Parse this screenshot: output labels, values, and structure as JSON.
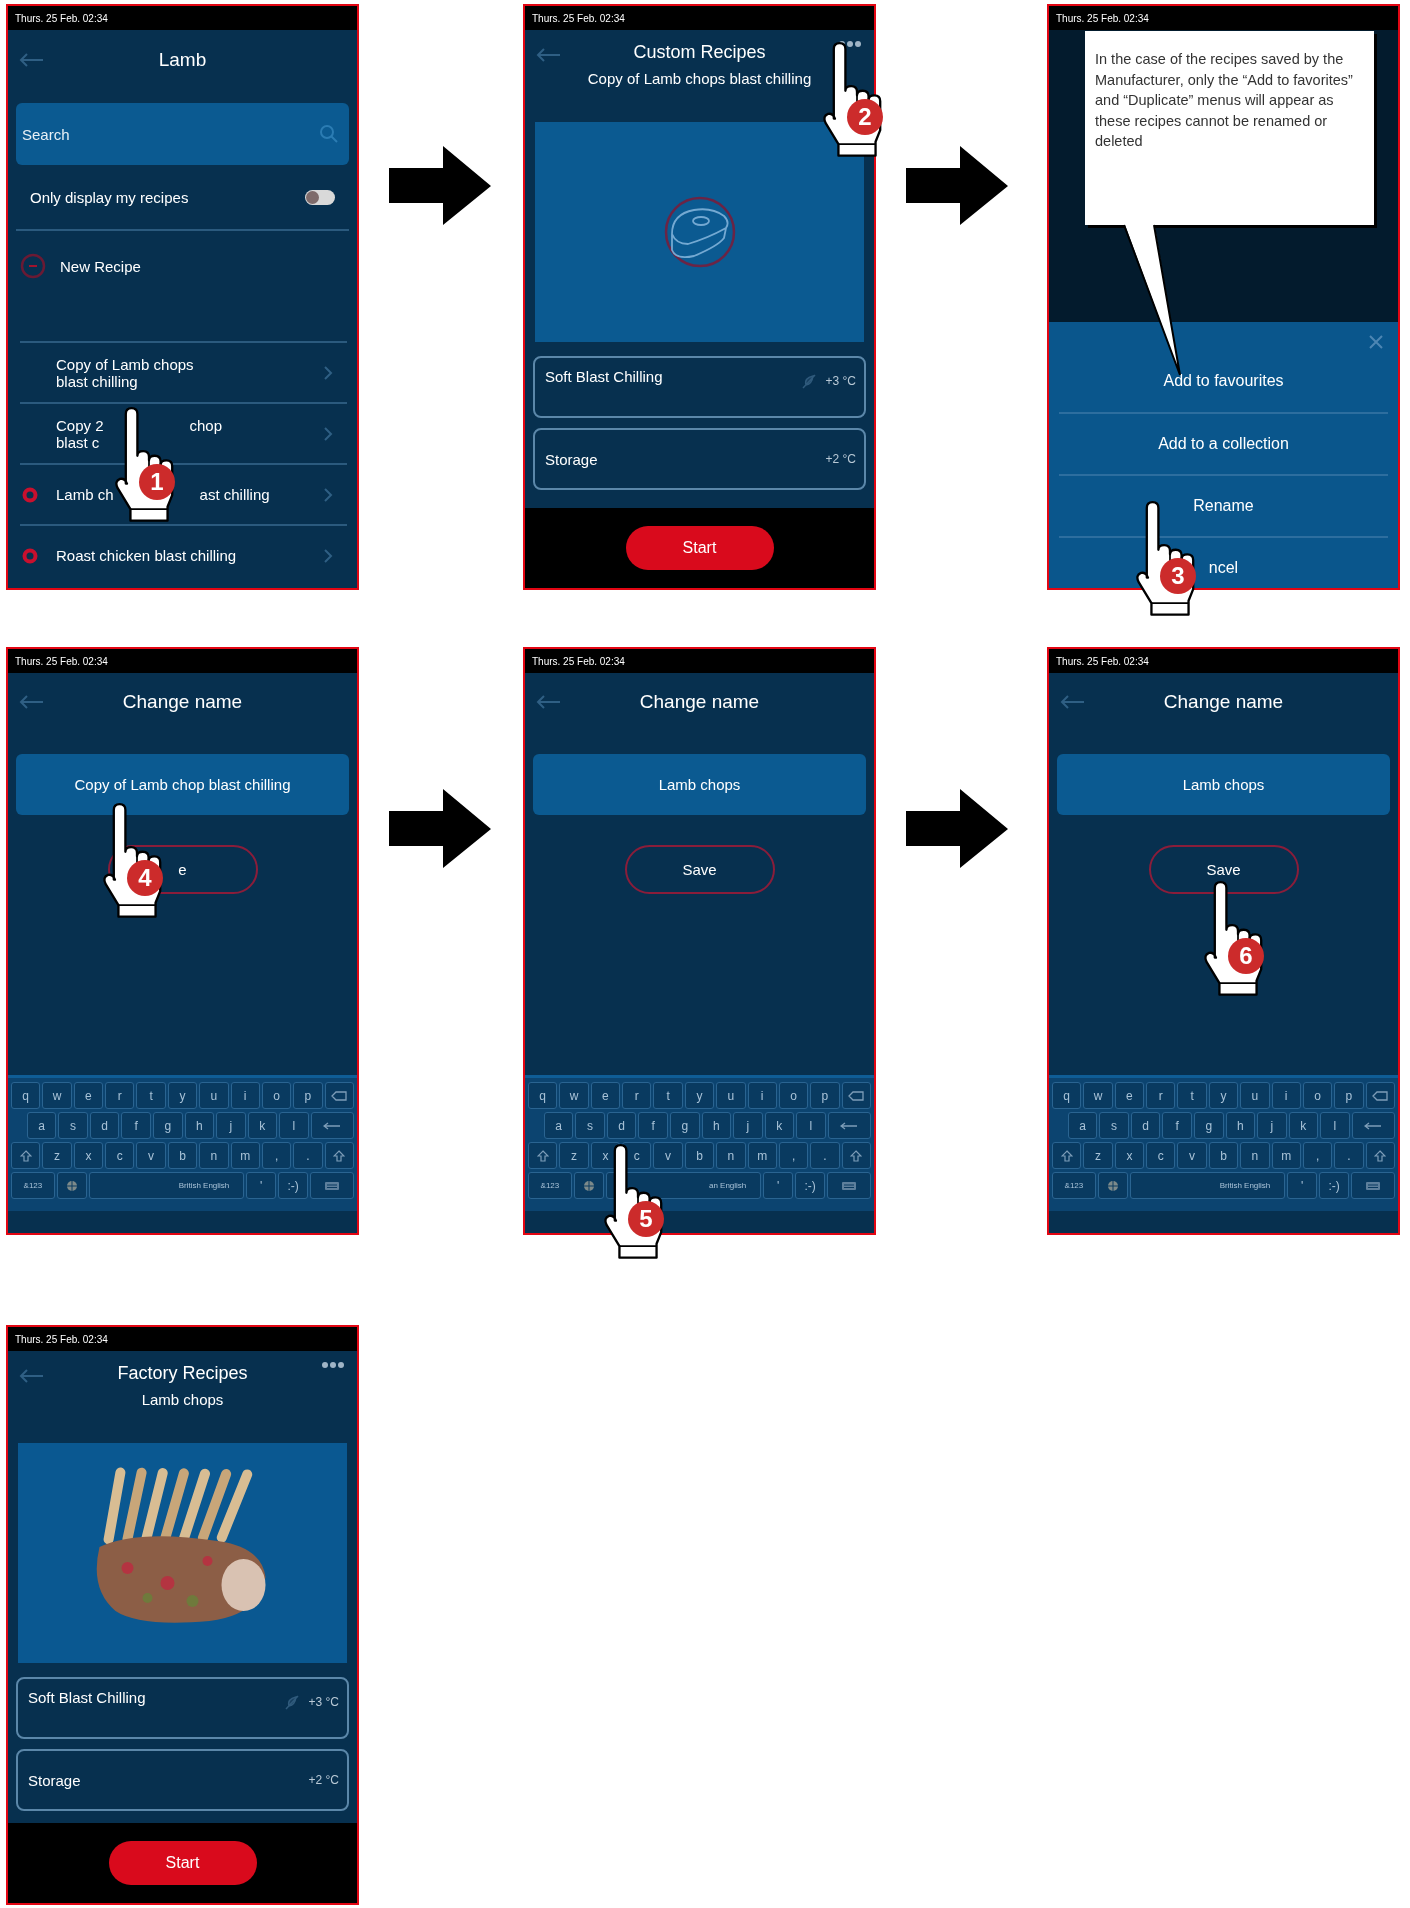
{
  "screens": [
    {
      "kind": "recipe_list",
      "status": "Thurs. 25 Feb. 02:34",
      "title": "Lamb",
      "search": {
        "placeholder": "Search"
      },
      "filter": {
        "label": "Only display my recipes",
        "on": false
      },
      "new_recipe": "New Recipe",
      "recipes": [
        {
          "lines": [
            [
              "Copy of Lamb chops"
            ],
            [
              "blast chilling"
            ]
          ],
          "marked": false
        },
        {
          "lines": [
            [
              "Copy 2",
              "chop"
            ],
            [
              "blast c"
            ]
          ],
          "marked": false
        },
        {
          "lines": [
            [
              "Lamb ch",
              "ast chilling"
            ]
          ],
          "marked": true
        },
        {
          "lines": [
            [
              "Roast chicken blast chilling"
            ]
          ],
          "marked": true
        }
      ],
      "step": "1"
    },
    {
      "kind": "recipe_detail",
      "status": "Thurs. 25 Feb. 02:34",
      "title": "Custom Recipes",
      "subtitle": "Copy of Lamb chops blast chilling",
      "image": {
        "kind": "icon"
      },
      "phases": [
        {
          "name": "Soft Blast Chilling",
          "temp": "+3 °C",
          "chill_icon": true
        },
        {
          "name": "Storage",
          "temp": "+2 °C",
          "chill_icon": false
        }
      ],
      "start": "Start",
      "step": "2"
    },
    {
      "kind": "action_menu",
      "status": "Thurs. 25 Feb. 02:34",
      "callout": "In the case of the recipes saved by the Manufacturer, only the “Add to favorites” and “Duplicate” menus will appear as these recipes cannot be renamed or deleted",
      "actions": [
        "Add to favourites",
        "Add to a collection",
        "Rename",
        "ncel"
      ],
      "step": "3"
    },
    {
      "kind": "rename",
      "status": "Thurs. 25 Feb. 02:34",
      "title": "Change name",
      "value": "Copy of Lamb chop blast chilling",
      "save": "e",
      "step": "4",
      "keyboard": [
        [
          {
            "kind": "letter",
            "label": "q"
          },
          {
            "kind": "letter",
            "label": "w"
          },
          {
            "kind": "letter",
            "label": "e"
          },
          {
            "kind": "letter",
            "label": "r"
          },
          {
            "kind": "letter",
            "label": "t"
          },
          {
            "kind": "letter",
            "label": "y"
          },
          {
            "kind": "letter",
            "label": "u"
          },
          {
            "kind": "letter",
            "label": "i"
          },
          {
            "kind": "letter",
            "label": "o"
          },
          {
            "kind": "letter",
            "label": "p"
          },
          {
            "kind": "backspace"
          }
        ],
        [
          {
            "kind": "letter",
            "label": "a"
          },
          {
            "kind": "letter",
            "label": "s"
          },
          {
            "kind": "letter",
            "label": "d"
          },
          {
            "kind": "letter",
            "label": "f"
          },
          {
            "kind": "letter",
            "label": "g"
          },
          {
            "kind": "letter",
            "label": "h"
          },
          {
            "kind": "letter",
            "label": "j"
          },
          {
            "kind": "letter",
            "label": "k"
          },
          {
            "kind": "letter",
            "label": "l"
          },
          {
            "kind": "enter"
          }
        ],
        [
          {
            "kind": "shift"
          },
          {
            "kind": "letter",
            "label": "z"
          },
          {
            "kind": "letter",
            "label": "x"
          },
          {
            "kind": "letter",
            "label": "c"
          },
          {
            "kind": "letter",
            "label": "v"
          },
          {
            "kind": "letter",
            "label": "b"
          },
          {
            "kind": "letter",
            "label": "n"
          },
          {
            "kind": "letter",
            "label": "m"
          },
          {
            "kind": "letter",
            "label": ","
          },
          {
            "kind": "letter",
            "label": "."
          },
          {
            "kind": "shift"
          }
        ],
        [
          {
            "kind": "mode",
            "label": "&123"
          },
          {
            "kind": "globe"
          },
          {
            "kind": "space",
            "label": "British English"
          },
          {
            "kind": "letter",
            "label": "'"
          },
          {
            "kind": "letter",
            "label": ":-)"
          },
          {
            "kind": "hide"
          }
        ]
      ]
    },
    {
      "kind": "rename",
      "status": "Thurs. 25 Feb. 02:34",
      "title": "Change name",
      "value": "Lamb chops",
      "save": "Save",
      "step": "5",
      "keyboard": [
        [
          {
            "kind": "letter",
            "label": "q"
          },
          {
            "kind": "letter",
            "label": "w"
          },
          {
            "kind": "letter",
            "label": "e"
          },
          {
            "kind": "letter",
            "label": "r"
          },
          {
            "kind": "letter",
            "label": "t"
          },
          {
            "kind": "letter",
            "label": "y"
          },
          {
            "kind": "letter",
            "label": "u"
          },
          {
            "kind": "letter",
            "label": "i"
          },
          {
            "kind": "letter",
            "label": "o"
          },
          {
            "kind": "letter",
            "label": "p"
          },
          {
            "kind": "backspace"
          }
        ],
        [
          {
            "kind": "letter",
            "label": "a"
          },
          {
            "kind": "letter",
            "label": "s"
          },
          {
            "kind": "letter",
            "label": "d"
          },
          {
            "kind": "letter",
            "label": "f"
          },
          {
            "kind": "letter",
            "label": "g"
          },
          {
            "kind": "letter",
            "label": "h"
          },
          {
            "kind": "letter",
            "label": "j"
          },
          {
            "kind": "letter",
            "label": "k"
          },
          {
            "kind": "letter",
            "label": "l"
          },
          {
            "kind": "enter"
          }
        ],
        [
          {
            "kind": "shift"
          },
          {
            "kind": "letter",
            "label": "z"
          },
          {
            "kind": "letter",
            "label": "x"
          },
          {
            "kind": "letter",
            "label": "c"
          },
          {
            "kind": "letter",
            "label": "v"
          },
          {
            "kind": "letter",
            "label": "b"
          },
          {
            "kind": "letter",
            "label": "n"
          },
          {
            "kind": "letter",
            "label": "m"
          },
          {
            "kind": "letter",
            "label": ","
          },
          {
            "kind": "letter",
            "label": "."
          },
          {
            "kind": "shift"
          }
        ],
        [
          {
            "kind": "mode",
            "label": "&123"
          },
          {
            "kind": "globe"
          },
          {
            "kind": "space",
            "label": "an English"
          },
          {
            "kind": "letter",
            "label": "'"
          },
          {
            "kind": "letter",
            "label": ":-)"
          },
          {
            "kind": "hide"
          }
        ]
      ]
    },
    {
      "kind": "rename",
      "status": "Thurs. 25 Feb. 02:34",
      "title": "Change name",
      "value": "Lamb chops",
      "save": "Save",
      "step": "6",
      "keyboard": [
        [
          {
            "kind": "letter",
            "label": "q"
          },
          {
            "kind": "letter",
            "label": "w"
          },
          {
            "kind": "letter",
            "label": "e"
          },
          {
            "kind": "letter",
            "label": "r"
          },
          {
            "kind": "letter",
            "label": "t"
          },
          {
            "kind": "letter",
            "label": "y"
          },
          {
            "kind": "letter",
            "label": "u"
          },
          {
            "kind": "letter",
            "label": "i"
          },
          {
            "kind": "letter",
            "label": "o"
          },
          {
            "kind": "letter",
            "label": "p"
          },
          {
            "kind": "backspace"
          }
        ],
        [
          {
            "kind": "letter",
            "label": "a"
          },
          {
            "kind": "letter",
            "label": "s"
          },
          {
            "kind": "letter",
            "label": "d"
          },
          {
            "kind": "letter",
            "label": "f"
          },
          {
            "kind": "letter",
            "label": "g"
          },
          {
            "kind": "letter",
            "label": "h"
          },
          {
            "kind": "letter",
            "label": "j"
          },
          {
            "kind": "letter",
            "label": "k"
          },
          {
            "kind": "letter",
            "label": "l"
          },
          {
            "kind": "enter"
          }
        ],
        [
          {
            "kind": "shift"
          },
          {
            "kind": "letter",
            "label": "z"
          },
          {
            "kind": "letter",
            "label": "x"
          },
          {
            "kind": "letter",
            "label": "c"
          },
          {
            "kind": "letter",
            "label": "v"
          },
          {
            "kind": "letter",
            "label": "b"
          },
          {
            "kind": "letter",
            "label": "n"
          },
          {
            "kind": "letter",
            "label": "m"
          },
          {
            "kind": "letter",
            "label": ","
          },
          {
            "kind": "letter",
            "label": "."
          },
          {
            "kind": "shift"
          }
        ],
        [
          {
            "kind": "mode",
            "label": "&123"
          },
          {
            "kind": "globe"
          },
          {
            "kind": "space",
            "label": "British English"
          },
          {
            "kind": "letter",
            "label": "'"
          },
          {
            "kind": "letter",
            "label": ":-)"
          },
          {
            "kind": "hide"
          }
        ]
      ]
    },
    {
      "kind": "recipe_detail",
      "status": "Thurs. 25 Feb. 02:34",
      "title": "Factory Recipes",
      "subtitle": "Lamb chops",
      "phases": [
        {
          "name": "Soft Blast Chilling",
          "temp": "+3 °C",
          "chill_icon": true
        },
        {
          "name": "Storage",
          "temp": "+2 °C",
          "chill_icon": false
        }
      ],
      "start": "Start"
    }
  ]
}
